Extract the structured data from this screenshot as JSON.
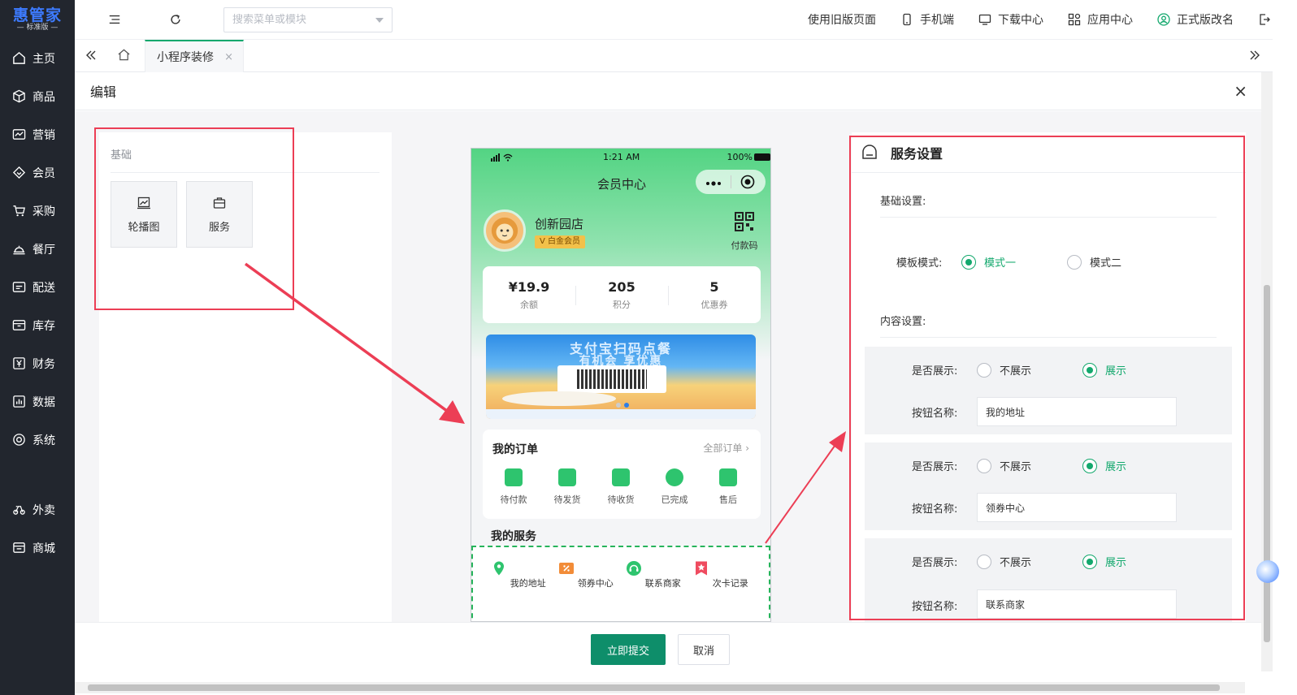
{
  "app": {
    "logo_main": "惠管家",
    "logo_sub": "— 标准版 —"
  },
  "sidebar": {
    "items": [
      {
        "label": "主页",
        "icon": "home-icon"
      },
      {
        "label": "商品",
        "icon": "box-icon"
      },
      {
        "label": "营销",
        "icon": "trend-icon"
      },
      {
        "label": "会员",
        "icon": "diamond-icon"
      },
      {
        "label": "采购",
        "icon": "cart-icon"
      },
      {
        "label": "餐厅",
        "icon": "dish-icon"
      },
      {
        "label": "配送",
        "icon": "truck-icon"
      },
      {
        "label": "库存",
        "icon": "inbox-icon"
      },
      {
        "label": "财务",
        "icon": "yen-icon"
      },
      {
        "label": "数据",
        "icon": "chart-icon"
      },
      {
        "label": "系统",
        "icon": "target-icon"
      }
    ],
    "extra_items": [
      {
        "label": "外卖",
        "icon": "bike-icon"
      },
      {
        "label": "商城",
        "icon": "store-icon"
      }
    ]
  },
  "topbar": {
    "search_placeholder": "搜索菜单或模块",
    "links": [
      {
        "label": "使用旧版页面",
        "icon": ""
      },
      {
        "label": "手机端",
        "icon": "phone-icon"
      },
      {
        "label": "下载中心",
        "icon": "monitor-icon"
      },
      {
        "label": "应用中心",
        "icon": "grid-icon"
      },
      {
        "label": "正式版改名",
        "icon": "user-icon"
      }
    ]
  },
  "tabs": {
    "active_label": "小程序装修",
    "close": "×"
  },
  "editor": {
    "title": "编辑",
    "close": "×",
    "components": {
      "section_title": "基础",
      "items": [
        {
          "label": "轮播图",
          "icon": "image-icon"
        },
        {
          "label": "服务",
          "icon": "briefcase-icon"
        }
      ]
    },
    "phone": {
      "status_time": "1:21 AM",
      "status_battery": "100%",
      "page_title": "会员中心",
      "store_name": "创新园店",
      "vip_badge": "V 白金会员",
      "paycode_label": "付款码",
      "stats": [
        {
          "value": "¥19.9",
          "label": "余额"
        },
        {
          "value": "205",
          "label": "积分"
        },
        {
          "value": "5",
          "label": "优惠券"
        }
      ],
      "banner_line1": "支付宝扫码点餐",
      "banner_line2": "有机会 享优惠",
      "orders_title": "我的订单",
      "orders_all": "全部订单 ›",
      "order_items": [
        "待付款",
        "待发货",
        "待收货",
        "已完成",
        "售后"
      ],
      "services_title": "我的服务",
      "services": [
        {
          "label": "我的地址",
          "color": "#2ec46e"
        },
        {
          "label": "领券中心",
          "color": "#f28c38"
        },
        {
          "label": "联系商家",
          "color": "#2ec46e"
        },
        {
          "label": "次卡记录",
          "color": "#ef4b5f"
        }
      ]
    },
    "settings": {
      "title": "服务设置",
      "basic_label": "基础设置:",
      "template_label": "模板模式:",
      "template_options": [
        {
          "label": "模式一",
          "checked": true
        },
        {
          "label": "模式二",
          "checked": false
        }
      ],
      "content_label": "内容设置:",
      "show_label": "是否展示:",
      "name_label": "按钮名称:",
      "option_hide": "不展示",
      "option_show": "展示",
      "groups": [
        {
          "button_name": "我的地址",
          "show": true
        },
        {
          "button_name": "领券中心",
          "show": true
        },
        {
          "button_name": "联系商家",
          "show": true
        }
      ]
    },
    "footer": {
      "submit": "立即提交",
      "cancel": "取消"
    }
  },
  "colors": {
    "sidebar_bg": "#22262e",
    "accent_green": "#13a86d",
    "primary_button": "#0e8e6a",
    "annotation_red": "#ec3e55"
  }
}
